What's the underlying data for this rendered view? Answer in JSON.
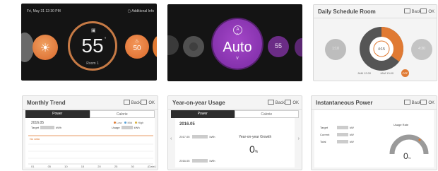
{
  "colors": {
    "orange": "#e07a33",
    "purple": "#8e36b5",
    "dark": "#141414",
    "gray_box": "#cccccc"
  },
  "temperature_panel": {
    "datetime": "Fri, May 31 12:30 PM",
    "header_right": "Additional Info",
    "current_temp": "55",
    "degree_symbol": "°",
    "room_label": "Room 1",
    "next_setpoint": "50",
    "icons": [
      "sun-icon",
      "mode-icon",
      "heat-icon"
    ]
  },
  "mode_panel": {
    "mode_label": "Auto",
    "up_arrow": "^",
    "down_arrow": "v",
    "next_value": "55",
    "icons": [
      "auto-mode-icon",
      "fan-icon"
    ]
  },
  "schedule_panel": {
    "title": "Daily Schedule Room",
    "back_label": "Back",
    "ok_label": "OK",
    "left_item": "1:10",
    "center_item": "4:15",
    "right_item": "4:30",
    "legend_a": "JAM 12:00",
    "legend_b": "JAM 13:00",
    "edit_badge": "OFF",
    "ring_fraction_orange": 0.35
  },
  "monthly_panel": {
    "title": "Monthly Trend",
    "back_label": "Back",
    "ok_label": "OK",
    "tab_active": "Power",
    "tab_inactive": "Calorie",
    "date": "2016.05",
    "target_label": "Target",
    "target_unit": "kWh",
    "usage_label": "Usage",
    "usage_unit": "kWh",
    "legend": [
      {
        "name": "Low",
        "color": "#e07a33"
      },
      {
        "name": "Mid",
        "color": "#55a0d8"
      },
      {
        "name": "High",
        "color": "#d8b03a"
      }
    ],
    "no_data": "No data",
    "x_ticks": [
      "01",
      "05",
      "10",
      "15",
      "20",
      "25",
      "30",
      "(Date)"
    ]
  },
  "yearly_panel": {
    "title": "Year-on-year Usage",
    "back_label": "Back",
    "ok_label": "OK",
    "tab_active": "Power",
    "tab_inactive": "Calorie",
    "year": "2016.05",
    "row1_label": "2017.05",
    "row1_unit": "kWh",
    "row2_label": "2016.05",
    "row2_unit": "kWh",
    "growth_label": "Year-on-year Growth",
    "growth_value": "0",
    "growth_unit": "%",
    "prev_arrow": "‹",
    "next_arrow": "›"
  },
  "power_panel": {
    "title": "Instantaneous Power",
    "back_label": "Back",
    "ok_label": "OK",
    "rows": [
      {
        "label": "Target",
        "unit": "kW"
      },
      {
        "label": "Current",
        "unit": "kW"
      },
      {
        "label": "Total",
        "unit": "kW"
      }
    ],
    "gauge_label": "Usage Rate",
    "gauge_value": "0",
    "gauge_unit": "%"
  }
}
